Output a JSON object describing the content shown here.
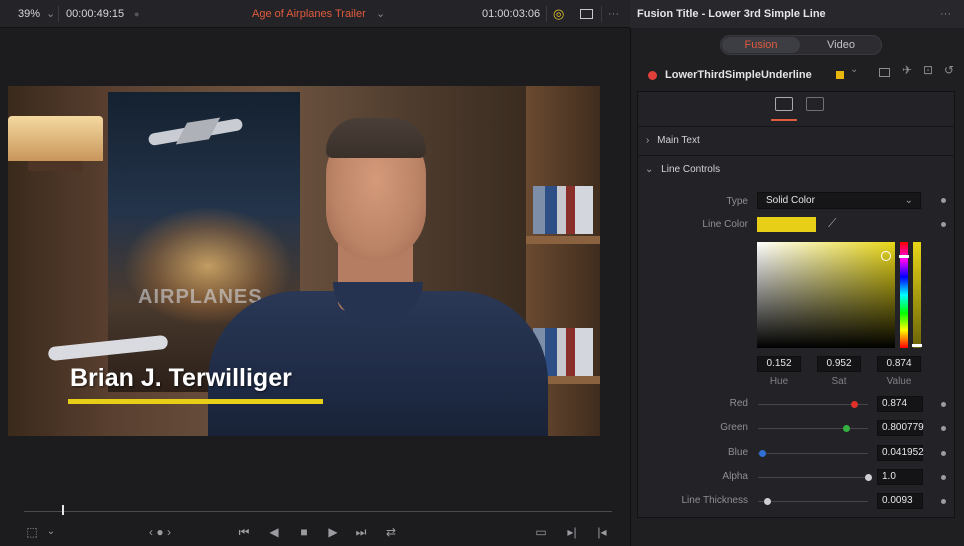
{
  "viewer": {
    "zoom": "39%",
    "timecode_left": "00:00:49:15",
    "title": "Age of Airplanes Trailer",
    "timecode_right": "01:00:03:06",
    "video": {
      "poster_text": "AIRPLANES",
      "lower_third_name": "Brian J. Terwilliger",
      "underline_color": "#e8cf17"
    },
    "scrubber_position": 0.065,
    "transport_icons": [
      "viewer-options-icon",
      "jog-icon",
      "skip-to-start-icon",
      "play-reverse-icon",
      "stop-icon",
      "play-icon",
      "skip-to-end-icon",
      "loop-icon",
      "match-frame-icon",
      "next-edit-icon",
      "prev-edit-icon"
    ]
  },
  "inspector": {
    "title": "Fusion Title - Lower 3rd Simple Line",
    "tabs": [
      "Fusion",
      "Video"
    ],
    "active_tab": "Fusion",
    "node_name": "LowerThirdSimpleUnderline",
    "node_color": "#e8b70f",
    "sections": {
      "main_text": "Main Text",
      "line_controls": "Line Controls"
    },
    "type_label": "Type",
    "type_value": "Solid Color",
    "line_color_label": "Line Color",
    "line_color": "#e8cf17",
    "hsv": {
      "hue": "0.152",
      "sat": "0.952",
      "value": "0.874",
      "hue_label": "Hue",
      "sat_label": "Sat",
      "value_label": "Value"
    },
    "sliders": [
      {
        "label": "Red",
        "value": "0.874",
        "fraction": 0.874,
        "color": "#e0302a"
      },
      {
        "label": "Green",
        "value": "0.800779",
        "fraction": 0.8,
        "color": "#33b040"
      },
      {
        "label": "Blue",
        "value": "0.041952",
        "fraction": 0.042,
        "color": "#2f6fd6"
      },
      {
        "label": "Alpha",
        "value": "1.0",
        "fraction": 1.0,
        "color": "#cfcfd3"
      },
      {
        "label": "Line Thickness",
        "value": "0.0093",
        "fraction": 0.09,
        "color": "#cfcfd3"
      }
    ]
  }
}
